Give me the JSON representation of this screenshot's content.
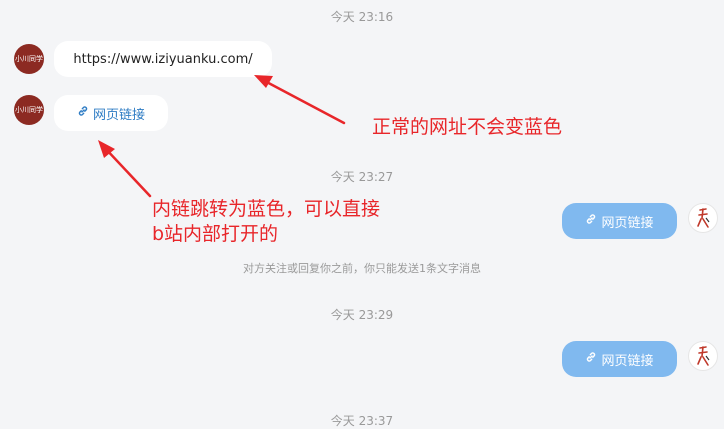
{
  "timestamps": [
    "今天 23:16",
    "今天 23:27",
    "今天 23:29",
    "今天 23:37"
  ],
  "messages": {
    "received_url": "https://www.iziyuanku.com/",
    "link_label": "网页链接"
  },
  "avatars": {
    "left_label": "小川同学"
  },
  "notice": "对方关注或回复你之前，你只能发送1条文字消息",
  "annotations": {
    "normal_url": "正常的网址不会变蓝色",
    "inner_link_line1": "内链跳转为蓝色，可以直接",
    "inner_link_line2": "b站内部打开的"
  },
  "colors": {
    "annotation": "#e8262a",
    "link_text": "#2e7cc4",
    "sent_bubble": "#80b9ef",
    "background": "#f4f5f7"
  },
  "icons": {
    "link": "link-icon"
  }
}
